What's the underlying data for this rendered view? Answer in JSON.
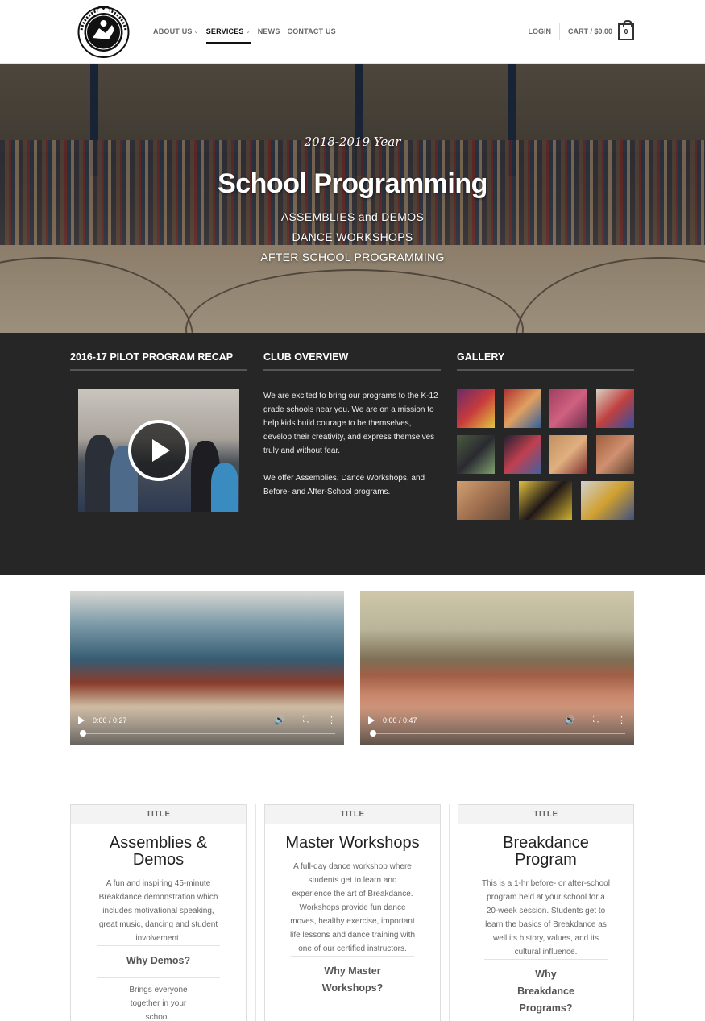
{
  "header": {
    "logo": "logo-emblem",
    "nav": [
      {
        "label": "ABOUT US",
        "dropdown": true,
        "active": false
      },
      {
        "label": "SERVICES",
        "dropdown": true,
        "active": true
      },
      {
        "label": "NEWS",
        "dropdown": false,
        "active": false
      },
      {
        "label": "CONTACT US",
        "dropdown": false,
        "active": false
      }
    ],
    "login": "LOGIN",
    "cart_label": "CART / $0.00",
    "cart_count": "0"
  },
  "hero": {
    "year": "2018-2019 Year",
    "title": "School Programming",
    "lines": [
      "ASSEMBLIES and DEMOS",
      "DANCE WORKSHOPS",
      "AFTER SCHOOL PROGRAMMING"
    ]
  },
  "recap": {
    "title": "2016-17 PILOT PROGRAM RECAP"
  },
  "overview": {
    "title": "CLUB OVERVIEW",
    "paragraphs": [
      "We are excited to bring our programs to the K-12 grade schools near you. We are on a mission to help kids build courage to be themselves, develop their creativity, and express themselves truly and without fear.",
      "We offer Assemblies, Dance Workshops, and Before- and After-School programs."
    ]
  },
  "gallery": {
    "title": "GALLERY"
  },
  "videos": [
    {
      "time": "0:00 / 0:27"
    },
    {
      "time": "0:00 / 0:47"
    }
  ],
  "cards": [
    {
      "tag": "TITLE",
      "title": "Assemblies & Demos",
      "desc": "A fun and inspiring 45-minute Breakdance demonstration which includes motivational speaking, great music, dancing and student involvement.",
      "why": "Why Demos?",
      "sub": "Brings everyone together in your school."
    },
    {
      "tag": "TITLE",
      "title": "Master Workshops",
      "desc": "A full-day dance workshop where students get to learn and experience the art of Breakdance. Workshops provide fun dance moves, healthy exercise, important life lessons and dance training with one of our certified instructors.",
      "why": "Why Master Workshops?",
      "sub": ""
    },
    {
      "tag": "TITLE",
      "title": "Breakdance Program",
      "desc": "This is a 1-hr before- or after-school program held at your school for a 20-week session. Students get to learn the basics of Breakdance as well its history, values, and its cultural influence.",
      "why": "Why Breakdance Programs?",
      "sub": ""
    }
  ]
}
